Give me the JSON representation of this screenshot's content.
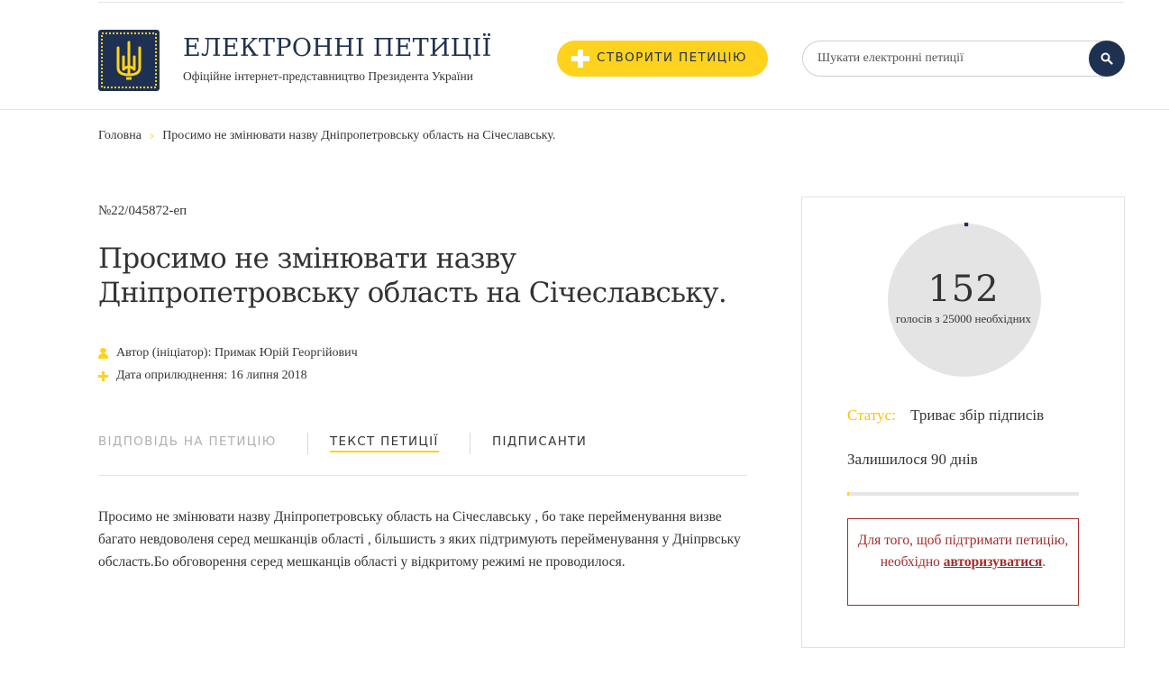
{
  "header": {
    "site_title": "ЕЛЕКТРОННІ ПЕТИЦІЇ",
    "site_subtitle": "Офіційне інтернет-представництво Президента України",
    "create_button": "СТВОРИТИ ПЕТИЦІЮ",
    "search_placeholder": "Шукати електронні петиції",
    "colors": {
      "brand": "#1f3152",
      "accent": "#ffd21e"
    }
  },
  "breadcrumb": {
    "home": "Головна",
    "current": "Просимо не змінювати назву Дніпропетровську область на Січеславську."
  },
  "petition": {
    "number": "№22/045872-еп",
    "title": "Просимо не змінювати назву Дніпропетровську область на Січеславську.",
    "author": "Автор (ініціатор): Примак Юрій Георгійович",
    "date": "Дата оприлюднення: 16 липня 2018",
    "tabs": {
      "answer": "ВІДПОВІДЬ НА ПЕТИЦІЮ",
      "text": "ТЕКСТ ПЕТИЦІЇ",
      "signers": "ПІДПИСАНТИ"
    },
    "body": "Просимо не змінювати назву Дніпропетровську область на Січеславську , бо таке перейменування визве багато невдоволеня серед мешканців області , більшисть з яких підтримують перейменування у Дніпрвську обсласть.Бо обговорення серед мешканців області у відкритому режимі не проводилося."
  },
  "sidebar": {
    "votes": "152",
    "votes_sub": "голосів з 25000 необхідних",
    "votes_progress_fraction": 0.006,
    "status_label": "Статус:",
    "status_value": "Триває збір підписів",
    "remaining": "Залишилося 90 днів",
    "time_progress_fraction": 0.005,
    "auth_text_before": "Для того, щоб підтримати петицію, необхідно",
    "auth_link": "авторизуватися",
    "auth_text_after": "."
  }
}
